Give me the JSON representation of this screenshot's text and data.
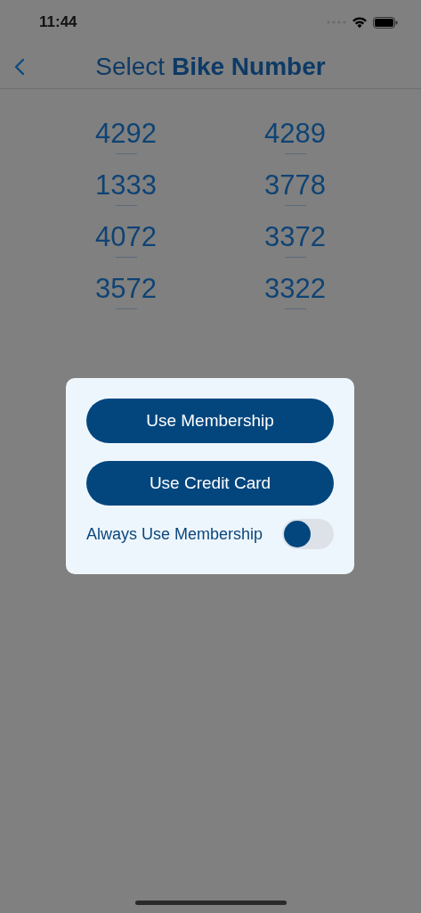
{
  "status_bar": {
    "time": "11:44"
  },
  "nav": {
    "title": "Select **Bike Number**"
  },
  "bikes": [
    "4292",
    "4289",
    "1333",
    "3778",
    "4072",
    "3372",
    "3572",
    "3322"
  ],
  "dialog": {
    "buttons": [
      "Use Membership",
      "Use Credit Card"
    ],
    "toggle": {
      "label": "Always Use Membership",
      "on": false
    }
  }
}
